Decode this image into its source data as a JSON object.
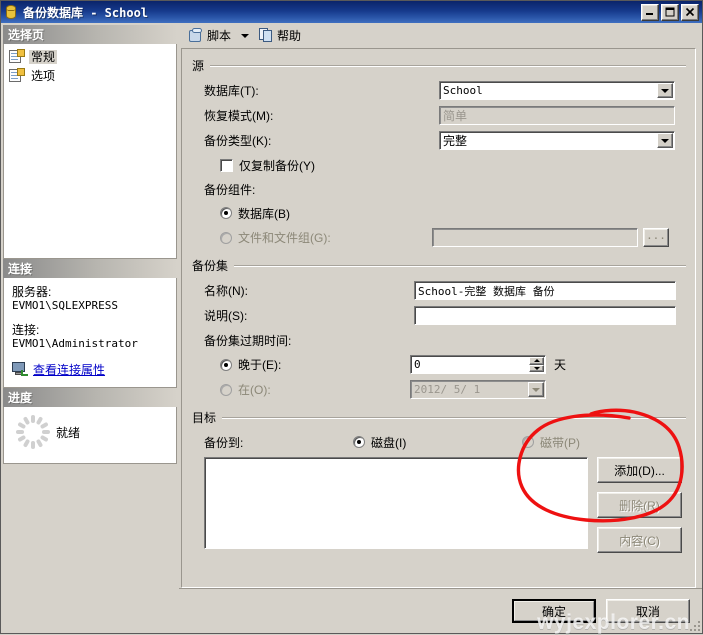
{
  "window": {
    "title": "备份数据库 - School",
    "icon": "database-icon",
    "buttons": {
      "minimize": "_",
      "maximize": "□",
      "close": "✕"
    }
  },
  "sidebar": {
    "pages_header": "选择页",
    "pages": [
      {
        "label": "常规",
        "selected": true
      },
      {
        "label": "选项",
        "selected": false
      }
    ],
    "connection_header": "连接",
    "connection": {
      "server_label": "服务器:",
      "server_value": "EVMO1\\SQLEXPRESS",
      "connection_label": "连接:",
      "connection_value": "EVMO1\\Administrator",
      "link": "查看连接属性"
    },
    "progress_header": "进度",
    "progress": {
      "status": "就绪"
    }
  },
  "toolbar": {
    "script_label": "脚本",
    "help_label": "帮助"
  },
  "source": {
    "title": "源",
    "database_label": "数据库(T):",
    "database_value": "School",
    "recovery_label": "恢复模式(M):",
    "recovery_value": "简单",
    "backup_type_label": "备份类型(K):",
    "backup_type_value": "完整",
    "copy_only_label": "仅复制备份(Y)",
    "copy_only_checked": false,
    "component_label": "备份组件:",
    "component_db_label": "数据库(B)",
    "component_db_checked": true,
    "component_files_label": "文件和文件组(G):",
    "component_files_checked": false,
    "component_files_value": "",
    "browse_label": "..."
  },
  "backup_set": {
    "title": "备份集",
    "name_label": "名称(N):",
    "name_value": "School-完整 数据库 备份",
    "desc_label": "说明(S):",
    "desc_value": "",
    "expire_label": "备份集过期时间:",
    "after_label": "晚于(E):",
    "after_checked": true,
    "after_value": "0",
    "days_unit": "天",
    "on_label": "在(O):",
    "on_checked": false,
    "on_value": "2012/ 5/ 1"
  },
  "destination": {
    "title": "目标",
    "backup_to_label": "备份到:",
    "disk_label": "磁盘(I)",
    "disk_checked": true,
    "tape_label": "磁带(P)",
    "tape_checked": false,
    "tape_disabled": true,
    "items": [],
    "add_label": "添加(D)...",
    "remove_label": "删除(R)",
    "contents_label": "内容(C)"
  },
  "annotation": {
    "shape": "red-ellipse",
    "color": "#ee1111",
    "target": "添加(D)..."
  },
  "footer": {
    "ok_label": "确定",
    "cancel_label": "取消"
  },
  "watermark": "wyjexplorer.cn",
  "colors": {
    "titlebar_start": "#0a246a",
    "titlebar_end": "#3f6fc0",
    "dialog_face": "#d6d2ca",
    "field_bg": "#ffffff",
    "disabled_text": "#8c8878",
    "link": "#0000c8",
    "annotation": "#ee1111"
  }
}
